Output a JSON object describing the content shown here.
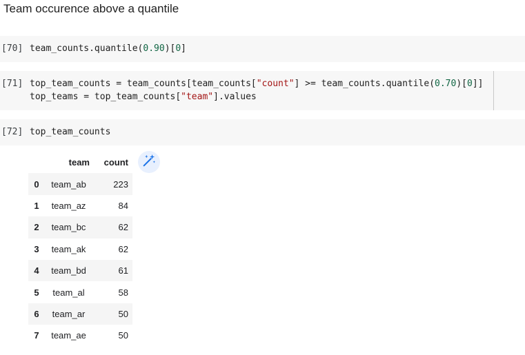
{
  "section": {
    "title": "Team occurence above a quantile"
  },
  "cells": [
    {
      "exec": "[70]",
      "lines": [
        [
          {
            "t": "team_counts.quantile(",
            "c": ""
          },
          {
            "t": "0.90",
            "c": "num"
          },
          {
            "t": ")[",
            "c": ""
          },
          {
            "t": "0",
            "c": "num"
          },
          {
            "t": "]",
            "c": ""
          }
        ]
      ]
    },
    {
      "exec": "[71]",
      "lines": [
        [
          {
            "t": "top_team_counts = team_counts[team_counts[",
            "c": ""
          },
          {
            "t": "\"count\"",
            "c": "str"
          },
          {
            "t": "] >= team_counts.quantile(",
            "c": ""
          },
          {
            "t": "0.70",
            "c": "num"
          },
          {
            "t": ")[",
            "c": ""
          },
          {
            "t": "0",
            "c": "num"
          },
          {
            "t": "]]",
            "c": ""
          }
        ],
        [
          {
            "t": "top_teams = top_team_counts[",
            "c": ""
          },
          {
            "t": "\"team\"",
            "c": "str"
          },
          {
            "t": "].values",
            "c": ""
          }
        ]
      ]
    },
    {
      "exec": "[72]",
      "lines": [
        [
          {
            "t": "top_team_counts",
            "c": ""
          }
        ]
      ]
    }
  ],
  "output_table": {
    "columns": [
      "team",
      "count"
    ],
    "rows": [
      {
        "index": "0",
        "team": "team_ab",
        "count": "223"
      },
      {
        "index": "1",
        "team": "team_az",
        "count": "84"
      },
      {
        "index": "2",
        "team": "team_bc",
        "count": "62"
      },
      {
        "index": "3",
        "team": "team_ak",
        "count": "62"
      },
      {
        "index": "4",
        "team": "team_bd",
        "count": "61"
      },
      {
        "index": "5",
        "team": "team_al",
        "count": "58"
      },
      {
        "index": "6",
        "team": "team_ar",
        "count": "50"
      },
      {
        "index": "7",
        "team": "team_ae",
        "count": "50"
      }
    ]
  },
  "icons": {
    "magic": "magic-wand-sparkle-icon"
  },
  "colors": {
    "code_bg": "#f7f7f7",
    "number": "#116644",
    "string": "#a31515",
    "magic_button_bg": "#e8f0fe",
    "magic_icon": "#1a73e8",
    "row_stripe": "#f5f5f5"
  }
}
